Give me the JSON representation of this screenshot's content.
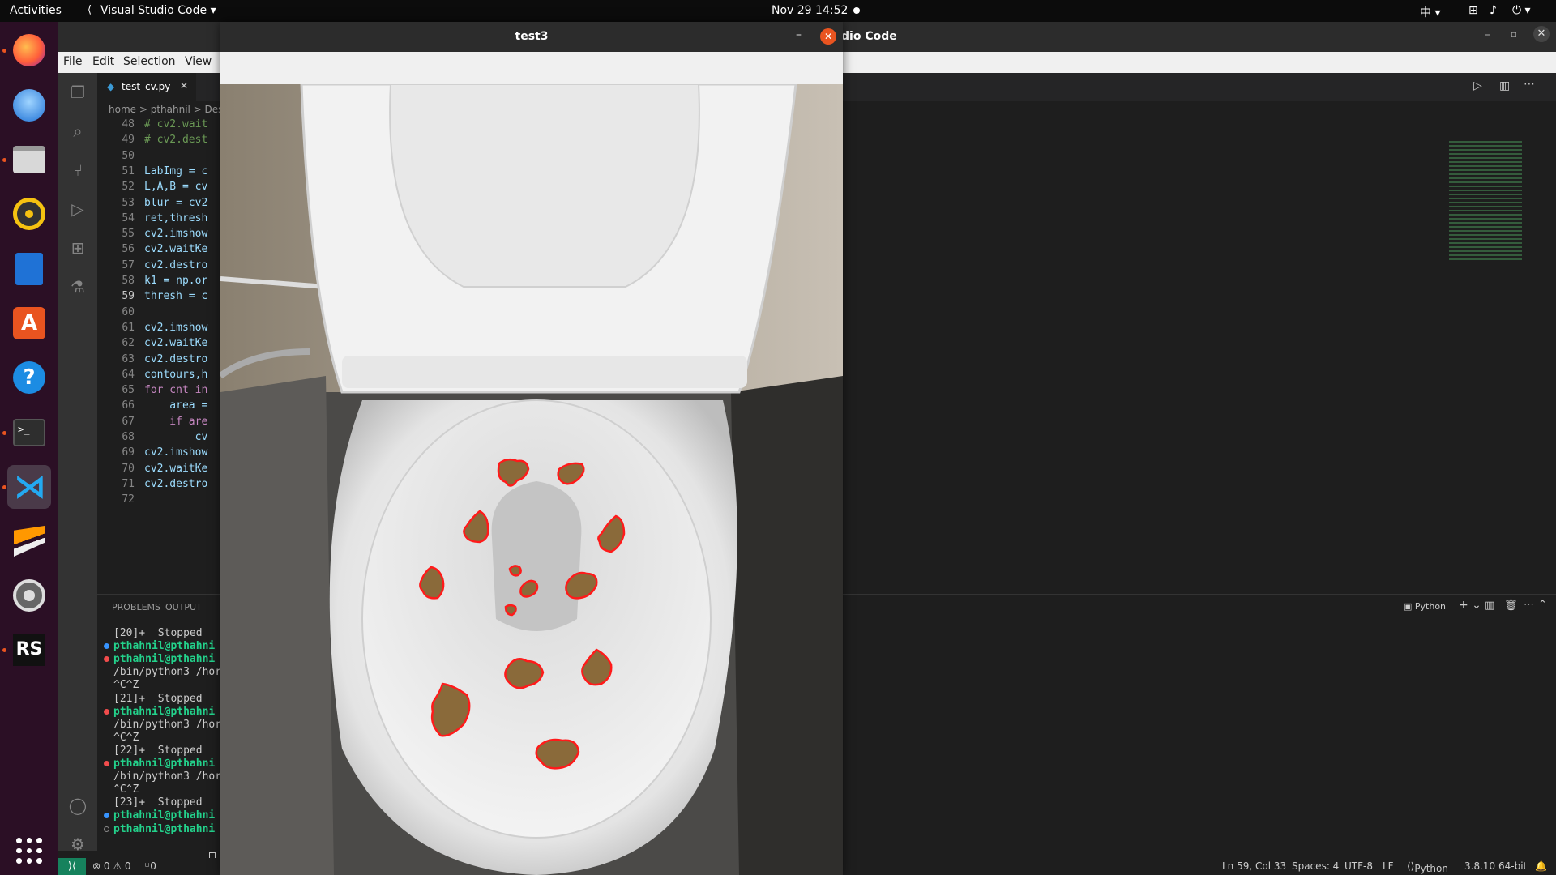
{
  "topbar": {
    "activities": "Activities",
    "app_name": "Visual Studio Code",
    "clock": "Nov 29  14:52",
    "input_method": "中"
  },
  "dock": {
    "items": [
      "firefox-icon",
      "thunderbird-icon",
      "files-icon",
      "rhythmbox-icon",
      "libreoffice-writer-icon",
      "app-center-icon",
      "help-icon",
      "terminal-icon",
      "vscode-icon",
      "sublime-icon",
      "settings-icon",
      "rstudio-icon"
    ],
    "show_apps": "show-applications-icon"
  },
  "vscode": {
    "title_suffix": "dio Code",
    "menu": [
      "File",
      "Edit",
      "Selection",
      "View"
    ],
    "tab": "test_cv.py",
    "breadcrumb": "home > pthahnil > Des",
    "code_lines": [
      {
        "n": "48",
        "t": "# cv2.wait",
        "c": "cm"
      },
      {
        "n": "49",
        "t": "# cv2.dest",
        "c": "cm"
      },
      {
        "n": "50",
        "t": "",
        "c": ""
      },
      {
        "n": "51",
        "t": "LabImg = c",
        "c": ""
      },
      {
        "n": "52",
        "t": "L,A,B = cv",
        "c": ""
      },
      {
        "n": "53",
        "t": "blur = cv2",
        "c": ""
      },
      {
        "n": "54",
        "t": "ret,thresh",
        "c": ""
      },
      {
        "n": "55",
        "t": "cv2.imshow",
        "c": ""
      },
      {
        "n": "56",
        "t": "cv2.waitKe",
        "c": ""
      },
      {
        "n": "57",
        "t": "cv2.destro",
        "c": ""
      },
      {
        "n": "58",
        "t": "k1 = np.or",
        "c": ""
      },
      {
        "n": "59",
        "t": "thresh = c",
        "c": ""
      },
      {
        "n": "60",
        "t": "",
        "c": ""
      },
      {
        "n": "61",
        "t": "cv2.imshow",
        "c": ""
      },
      {
        "n": "62",
        "t": "cv2.waitKe",
        "c": ""
      },
      {
        "n": "63",
        "t": "cv2.destro",
        "c": ""
      },
      {
        "n": "64",
        "t": "contours,h",
        "c": ""
      },
      {
        "n": "65",
        "t": "for cnt in",
        "c": "kw"
      },
      {
        "n": "66",
        "t": "    area =",
        "c": ""
      },
      {
        "n": "67",
        "t": "    if are",
        "c": "kw"
      },
      {
        "n": "68",
        "t": "        cv",
        "c": ""
      },
      {
        "n": "69",
        "t": "cv2.imshow",
        "c": ""
      },
      {
        "n": "70",
        "t": "cv2.waitKe",
        "c": ""
      },
      {
        "n": "71",
        "t": "cv2.destro",
        "c": ""
      },
      {
        "n": "72",
        "t": "",
        "c": ""
      }
    ],
    "current_line": "59",
    "panel_tabs": [
      "PROBLEMS",
      "OUTPUT"
    ],
    "terminal_profile": "Python",
    "terminal": [
      {
        "t": "[20]+  Stopped",
        "k": "plain",
        "dot": ""
      },
      {
        "t": "pthahnil@pthahni",
        "k": "grn",
        "dot": "blue"
      },
      {
        "t": "pthahnil@pthahni",
        "k": "grn",
        "dot": "red"
      },
      {
        "t": "/bin/python3 /hor",
        "k": "plain",
        "dot": ""
      },
      {
        "t": "^C^Z",
        "k": "plain",
        "dot": ""
      },
      {
        "t": "[21]+  Stopped",
        "k": "plain",
        "dot": ""
      },
      {
        "t": "pthahnil@pthahni",
        "k": "grn",
        "dot": "red"
      },
      {
        "t": "/bin/python3 /hor",
        "k": "plain",
        "dot": ""
      },
      {
        "t": "^C^Z",
        "k": "plain",
        "dot": ""
      },
      {
        "t": "[22]+  Stopped",
        "k": "plain",
        "dot": ""
      },
      {
        "t": "pthahnil@pthahni",
        "k": "grn",
        "dot": "red"
      },
      {
        "t": "/bin/python3 /hor",
        "k": "plain",
        "dot": ""
      },
      {
        "t": "^C^Z",
        "k": "plain",
        "dot": ""
      },
      {
        "t": "[23]+  Stopped",
        "k": "plain",
        "dot": ""
      },
      {
        "t": "pthahnil@pthahni",
        "k": "grn",
        "dot": "blue"
      },
      {
        "t": "pthahnil@pthahni",
        "k": "grn",
        "dot": "hollow"
      }
    ],
    "status": {
      "errors": "⊗ 0 ⚠ 0",
      "ports": "⑂0",
      "position": "Ln 59, Col 33",
      "spaces": "Spaces: 4",
      "encoding": "UTF-8",
      "eol": "LF",
      "language": "Python",
      "interpreter": "3.8.10 64-bit"
    }
  },
  "cv_window": {
    "title": "test3"
  },
  "colors": {
    "ubuntu_orange": "#e95420",
    "dock_bg": "#2b0f25",
    "contour_red": "#ff1a1a",
    "vscode_blue": "#007acc"
  }
}
